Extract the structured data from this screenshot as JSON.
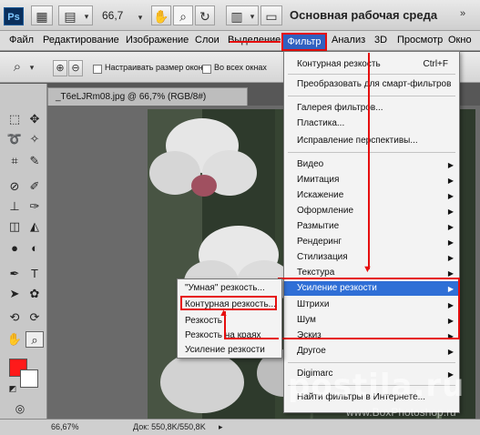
{
  "app": {
    "logo": "Ps",
    "zoom": "66,7",
    "workspace": "Основная рабочая среда"
  },
  "menu": [
    "Файл",
    "Редактирование",
    "Изображение",
    "Слои",
    "Выделение",
    "Фильтр",
    "Анализ",
    "3D",
    "Просмотр",
    "Окно"
  ],
  "options": {
    "fit_windows": "Настраивать размер окон",
    "all_windows": "Во всех окнах"
  },
  "document": {
    "tab_label": "_T6eLJRm08.jpg @ 66,7% (RGB/8#)",
    "close": "×"
  },
  "status": {
    "zoom": "66,67%",
    "doc": "Док: 550,8K/550,8K"
  },
  "filter_menu": {
    "last_filter": "Контурная резкость",
    "last_filter_shortcut": "Ctrl+F",
    "convert_smart": "Преобразовать для смарт-фильтров",
    "gallery": "Галерея фильтров...",
    "liquify": "Пластика...",
    "vanishing": "Исправление перспективы...",
    "groups": [
      "Видео",
      "Имитация",
      "Искажение",
      "Оформление",
      "Размытие",
      "Рендеринг",
      "Стилизация",
      "Текстура",
      "Усиление резкости",
      "Штрихи",
      "Шум",
      "Эскиз",
      "Другое"
    ],
    "digimarc": "Digimarc",
    "browse": "Найти фильтры в Интернете..."
  },
  "sharpen_submenu": [
    "\"Умная\" резкость...",
    "Контурная резкость...",
    "Резкость",
    "Резкость на краях",
    "Усиление резкости"
  ],
  "watermark": {
    "main": "postila.ru",
    "sub": "www.BoxPhotoshop.ru"
  },
  "colors": {
    "accent": "#e60e0e",
    "highlight": "#2f6fd6",
    "foreground_swatch": "#ff1a1a",
    "background_swatch": "#ffffff"
  }
}
